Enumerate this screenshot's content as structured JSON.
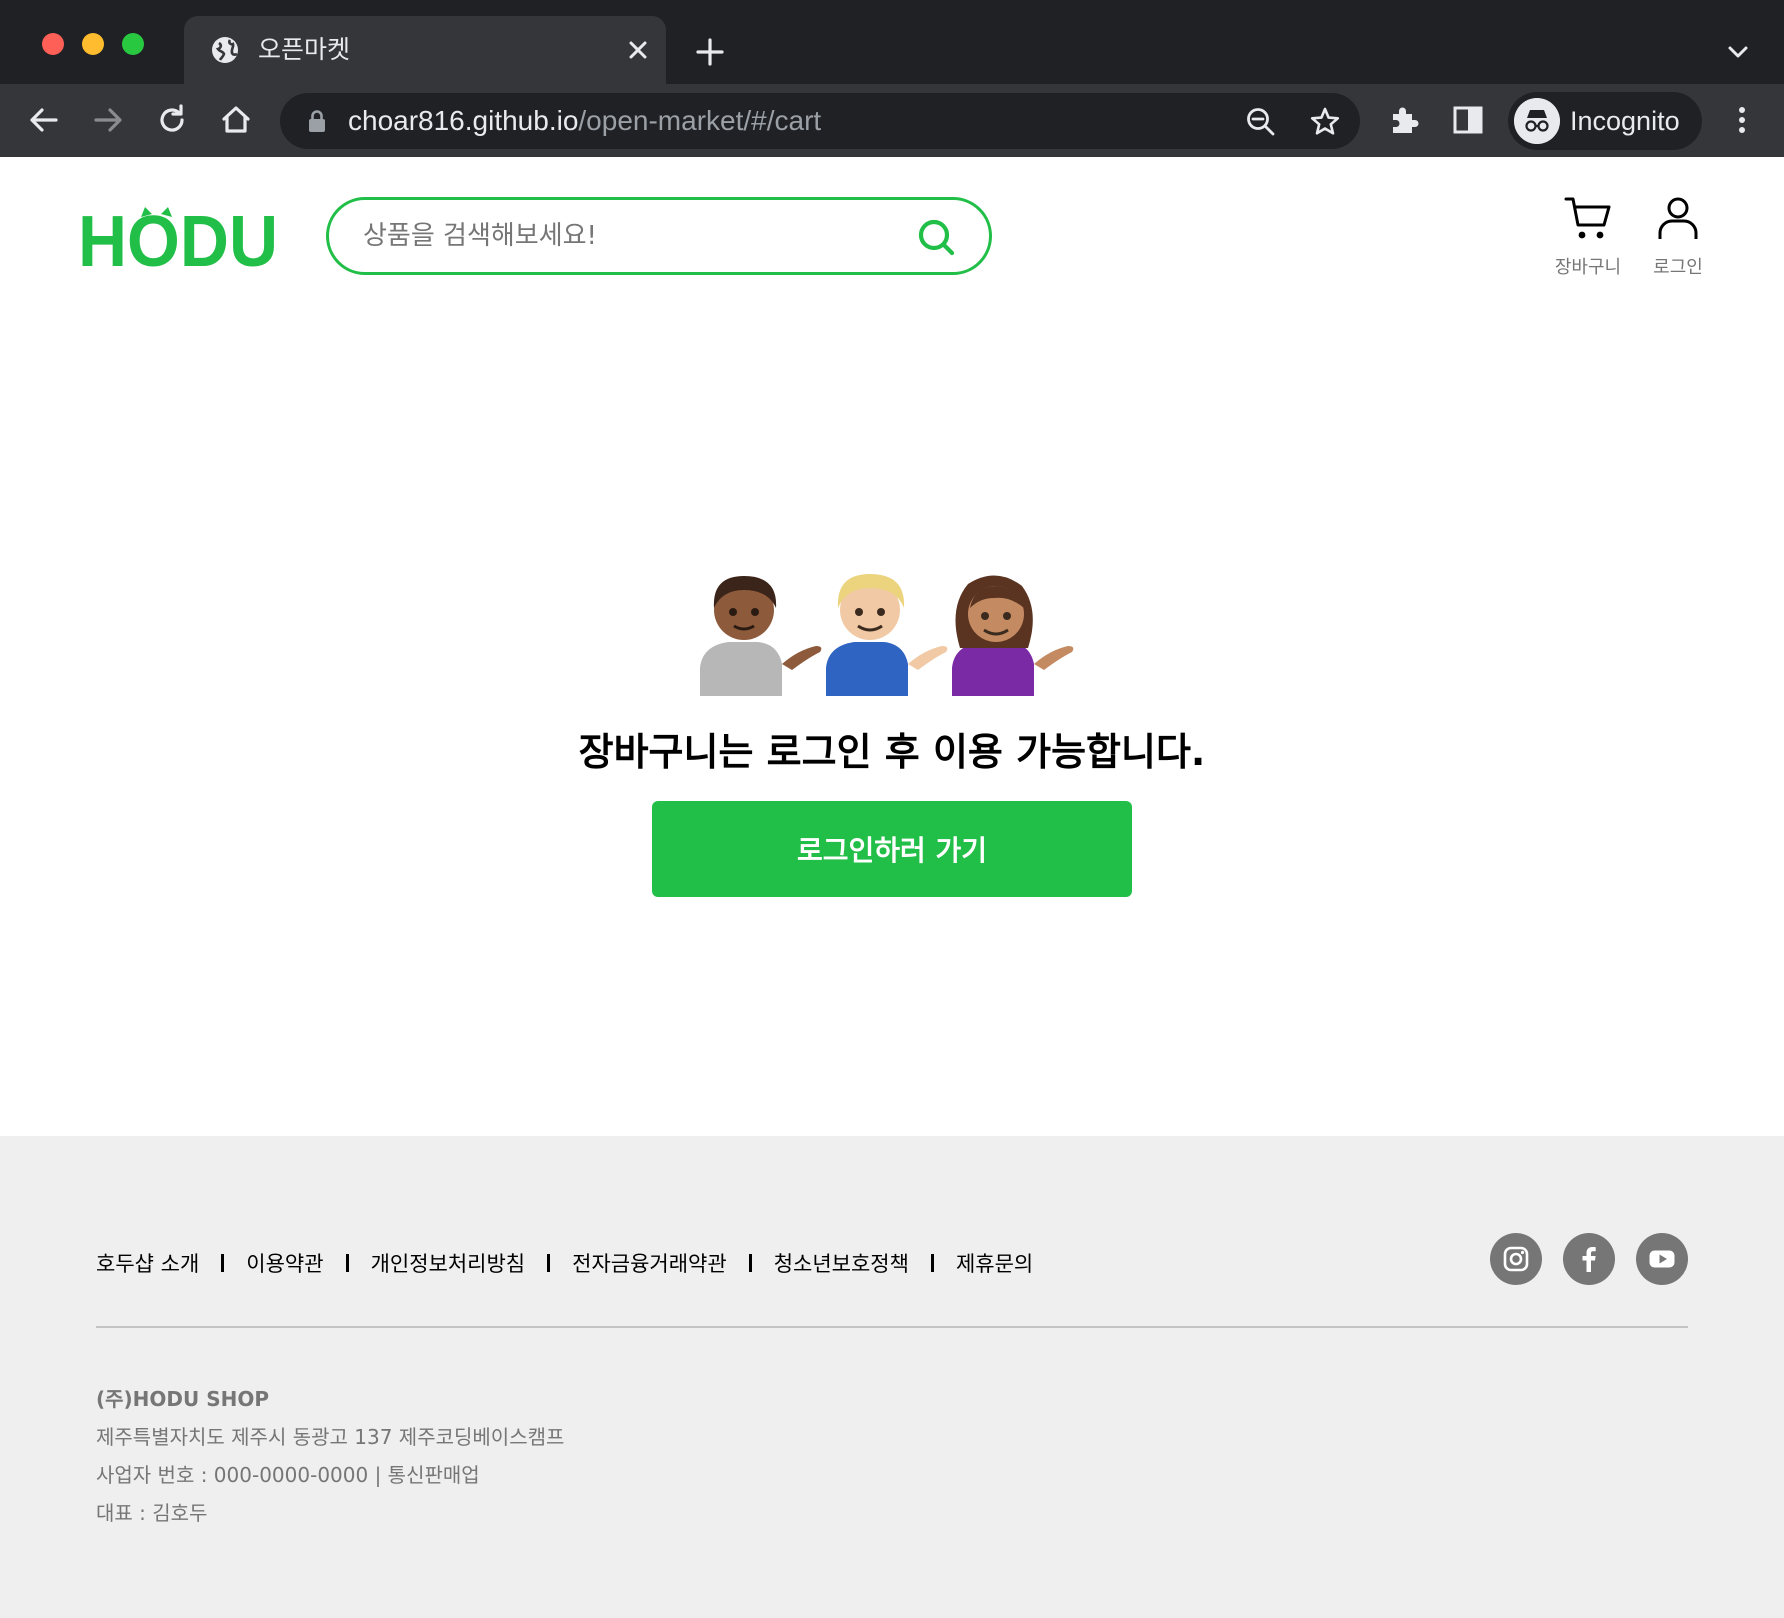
{
  "browser": {
    "tab_title": "오픈마켓",
    "url_host": "choar816.github.io",
    "url_path": "/open-market/#/cart",
    "profile_label": "Incognito"
  },
  "header": {
    "logo_text": "HODU",
    "search_placeholder": "상품을 검색해보세요!",
    "cart_label": "장바구니",
    "login_label": "로그인"
  },
  "main": {
    "emoji": [
      "🙋",
      "💁",
      "💁"
    ],
    "notice": "장바구니는 로그인 후 이용 가능합니다.",
    "login_button": "로그인하러 가기"
  },
  "footer": {
    "links": [
      "호두샵 소개",
      "이용약관",
      "개인정보처리방침",
      "전자금융거래약관",
      "청소년보호정책",
      "제휴문의"
    ],
    "social": [
      "instagram-icon",
      "facebook-icon",
      "youtube-icon"
    ],
    "company_name": "(주)HODU SHOP",
    "address": "제주특별자치도 제주시 동광고 137 제주코딩베이스캠프",
    "business": "사업자 번호 : 000-0000-0000 | 통신판매업",
    "ceo": "대표 : 김호두"
  },
  "colors": {
    "brand": "#21bf48",
    "chrome_dark": "#202124",
    "footer_bg": "#efefef",
    "muted_text": "#767676"
  }
}
